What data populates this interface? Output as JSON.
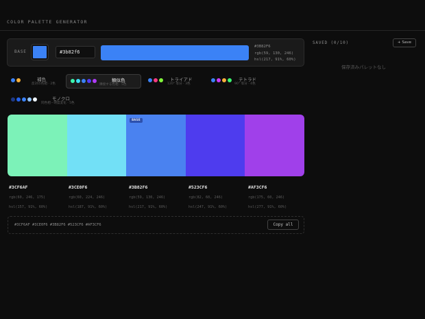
{
  "app": {
    "title": "COLOR PALETTE GENERATOR"
  },
  "base": {
    "label": "BASE",
    "hex_value": "#3b82f6",
    "color": "#3B82F6",
    "info_hex": "#3B82F6",
    "info_rgb": "rgb(59, 130, 246)",
    "info_hsl": "hsl(217, 91%, 60%)"
  },
  "saved": {
    "title": "SAVED (0/10)",
    "save_label": "+ Save",
    "empty_text": "保存済みパレットなし"
  },
  "harmonies": [
    {
      "name": "補色",
      "desc": "反対の色相 · 2色",
      "dots": [
        "#3B82F6",
        "#F6AF3B"
      ]
    },
    {
      "name": "類似色",
      "desc": "隣接する色相 · 5色",
      "dots": [
        "#3CF6AF",
        "#3CE0F6",
        "#3B82F6",
        "#523CF6",
        "#AF3CF6"
      ]
    },
    {
      "name": "トライアド",
      "desc": "120° 等分 · 3色",
      "dots": [
        "#3B82F6",
        "#F63B82",
        "#82F63B"
      ]
    },
    {
      "name": "テトラド",
      "desc": "90° 等分 · 4色",
      "dots": [
        "#3B82F6",
        "#C73BF6",
        "#F6AF3B",
        "#3BF66F"
      ]
    },
    {
      "name": "モノクロ",
      "desc": "同色相・明度変化 · 5色",
      "dots": [
        "#1E3A8A",
        "#2563EB",
        "#3B82F6",
        "#93C5FD",
        "#EFF6FF"
      ]
    }
  ],
  "active_harmony": "類似色",
  "palette": {
    "base_tag": "BASE",
    "colors": [
      {
        "hex": "#3CF6AF",
        "fill": "#7CF2B8",
        "rgb": "rgb(60, 246, 175)",
        "hsl": "hsl(157, 91%, 60%)"
      },
      {
        "hex": "#3CE0F6",
        "fill": "#72E0F6",
        "rgb": "rgb(60, 224, 246)",
        "hsl": "hsl(187, 91%, 60%)"
      },
      {
        "hex": "#3B82F6",
        "fill": "#4A82F0",
        "rgb": "rgb(59, 130, 246)",
        "hsl": "hsl(217, 91%, 60%)"
      },
      {
        "hex": "#523CF6",
        "fill": "#4E3CEE",
        "rgb": "rgb(82, 60, 246)",
        "hsl": "hsl(247, 91%, 60%)"
      },
      {
        "hex": "#AF3CF6",
        "fill": "#A040EA",
        "rgb": "rgb(175, 60, 246)",
        "hsl": "hsl(277, 91%, 60%)"
      }
    ]
  },
  "export": {
    "text": "#3CF6AF #3CE0F6 #3B82F6 #523CF6 #AF3CF6",
    "copy_label": "Copy all"
  }
}
